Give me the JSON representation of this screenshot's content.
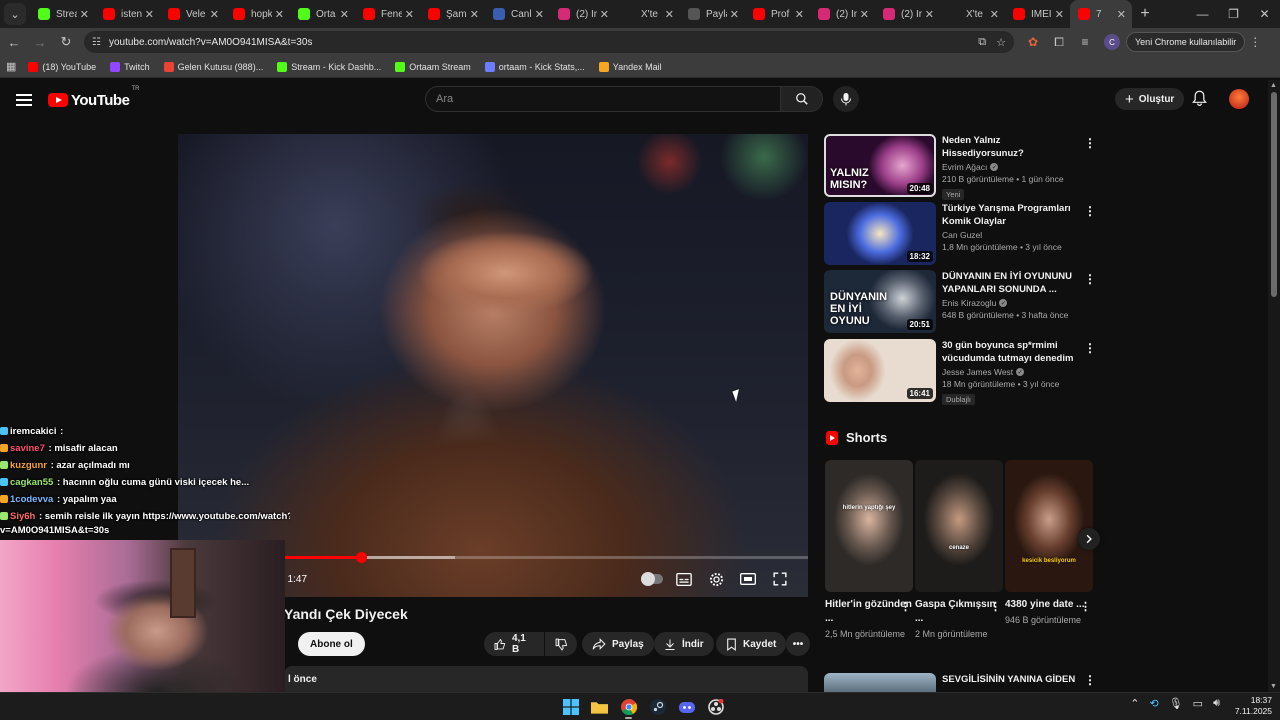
{
  "browser": {
    "tabs": [
      {
        "label": "Strea",
        "icon": "kick-icon",
        "color": "#53fc18"
      },
      {
        "label": "isten",
        "icon": "youtube-icon",
        "color": "#ff0000"
      },
      {
        "label": "Vele",
        "icon": "youtube-icon",
        "color": "#ff0000"
      },
      {
        "label": "hopk",
        "icon": "youtube-icon",
        "color": "#ff0000"
      },
      {
        "label": "Orta",
        "icon": "kick-icon",
        "color": "#53fc18"
      },
      {
        "label": "Fene",
        "icon": "youtube-icon",
        "color": "#ff0000"
      },
      {
        "label": "Şam",
        "icon": "youtube-icon",
        "color": "#ff0000"
      },
      {
        "label": "Canl",
        "icon": "m-icon",
        "color": "#3b5db0"
      },
      {
        "label": "(2) Ir",
        "icon": "instagram-icon",
        "color": "#d62976"
      },
      {
        "label": "X'te",
        "icon": "x-icon",
        "color": "#1f1f1f"
      },
      {
        "label": "Payla",
        "icon": "globe-icon",
        "color": "#555555"
      },
      {
        "label": "Prof",
        "icon": "youtube-icon",
        "color": "#ff0000"
      },
      {
        "label": "(2) Ir",
        "icon": "instagram-icon",
        "color": "#d62976"
      },
      {
        "label": "(2) Ir",
        "icon": "instagram-icon",
        "color": "#d62976"
      },
      {
        "label": "X'te",
        "icon": "x-icon",
        "color": "#1f1f1f"
      },
      {
        "label": "IMEI",
        "icon": "youtube-icon",
        "color": "#ff0000"
      },
      {
        "label": "7",
        "icon": "youtube-icon",
        "color": "#ff0000",
        "active": true
      }
    ],
    "url": "youtube.com/watch?v=AM0O941MISA&t=30s",
    "profile_initial": "C",
    "update_label": "Yeni Chrome kullanılabilir",
    "bookmarks": [
      {
        "label": "(18) YouTube",
        "icon": "youtube-icon",
        "color": "#ff0000"
      },
      {
        "label": "Twitch",
        "icon": "twitch-icon",
        "color": "#9146ff"
      },
      {
        "label": "Gelen Kutusu (988)...",
        "icon": "gmail-icon",
        "color": "#ea4335"
      },
      {
        "label": "Stream - Kick Dashb...",
        "icon": "kick-icon",
        "color": "#53fc18"
      },
      {
        "label": "Ortaam Stream",
        "icon": "kick-icon",
        "color": "#53fc18"
      },
      {
        "label": "ortaam - Kick Stats,...",
        "icon": "stats-icon",
        "color": "#6b7cff"
      },
      {
        "label": "Yandex Mail",
        "icon": "mail-icon",
        "color": "#f5a623"
      }
    ]
  },
  "youtube": {
    "logo_text": "YouTube",
    "logo_region": "TR",
    "search_placeholder": "Ara",
    "create_label": "Oluştur"
  },
  "player": {
    "time": "/ 1:47",
    "progress_played": 0.29,
    "progress_buffered": 0.44
  },
  "video": {
    "title": "Yandı Çek Diyecek",
    "subscribe_label": "Abone ol",
    "likes": "4,1 B",
    "share_label": "Paylaş",
    "download_label": "İndir",
    "save_label": "Kaydet",
    "description_snippet": "l önce"
  },
  "recommendations": [
    {
      "title": "Neden Yalnız Hissediyorsunuz?",
      "channel": "Evrim Ağacı",
      "verified": true,
      "meta": "210 B görüntüleme • 1 gün önce",
      "badge": "Yeni",
      "duration": "20:48",
      "thumb_text": "YALNIZ MISIN?"
    },
    {
      "title": "Türkiye Yarışma Programları Komik Olaylar",
      "channel": "Can Guzel",
      "verified": false,
      "meta": "1,8 Mn görüntüleme • 3 yıl önce",
      "badge": "",
      "duration": "18:32",
      "thumb_text": ""
    },
    {
      "title": "DÜNYANIN EN İYİ OYUNUNU YAPANLARI SONUNDA ...",
      "channel": "Enis Kirazoglu",
      "verified": true,
      "meta": "648 B görüntüleme • 3 hafta önce",
      "badge": "",
      "duration": "20:51",
      "thumb_text": "DÜNYANIN EN İYİ OYUNU"
    },
    {
      "title": "30 gün boyunca sp*rmimi vücudumda tutmayı denedim ...",
      "channel": "Jesse James West",
      "verified": true,
      "meta": "18 Mn görüntüleme • 3 yıl önce",
      "badge": "Dublajlı",
      "duration": "16:41",
      "thumb_text": ""
    }
  ],
  "shorts": {
    "heading": "Shorts",
    "items": [
      {
        "title": "Hitler'in gözünden ...",
        "views": "2,5 Mn görüntüleme",
        "caption": "hitlerin yaptığı şey"
      },
      {
        "title": "Gaspa Çıkmışsın ...",
        "views": "2 Mn görüntüleme",
        "caption": "cenaze"
      },
      {
        "title": "4380 yine date ...",
        "views": "946 B görüntüleme",
        "caption": "kesicik besliyorum"
      }
    ]
  },
  "rec_partial": {
    "title": "SEVGİLİSİNİN YANINA GİDEN"
  },
  "chat": [
    {
      "user": "iremcakici",
      "text": ":",
      "color": "#ffffff"
    },
    {
      "user": "savine7",
      "text": ": misafir alacan",
      "color": "#ff4d6d"
    },
    {
      "user": "kuzgunr",
      "text": ": azar açılmadı mı",
      "color": "#f5a623"
    },
    {
      "user": "cagkan55",
      "text": ": hacının oğlu cuma günü viski içecek he...",
      "color": "#9ae66e"
    },
    {
      "user": "1codevva",
      "text": ": yapalım yaa",
      "color": "#7ab8ff"
    },
    {
      "user": "Siy6h",
      "text": ": semih reisle ilk yayın https://www.youtube.com/watch?",
      "color": "#ff6b6b"
    }
  ],
  "chat_wrap": "v=AM0O941MISA&t=30s",
  "taskbar": {
    "time": "18:37",
    "date": "7.11.2025"
  }
}
